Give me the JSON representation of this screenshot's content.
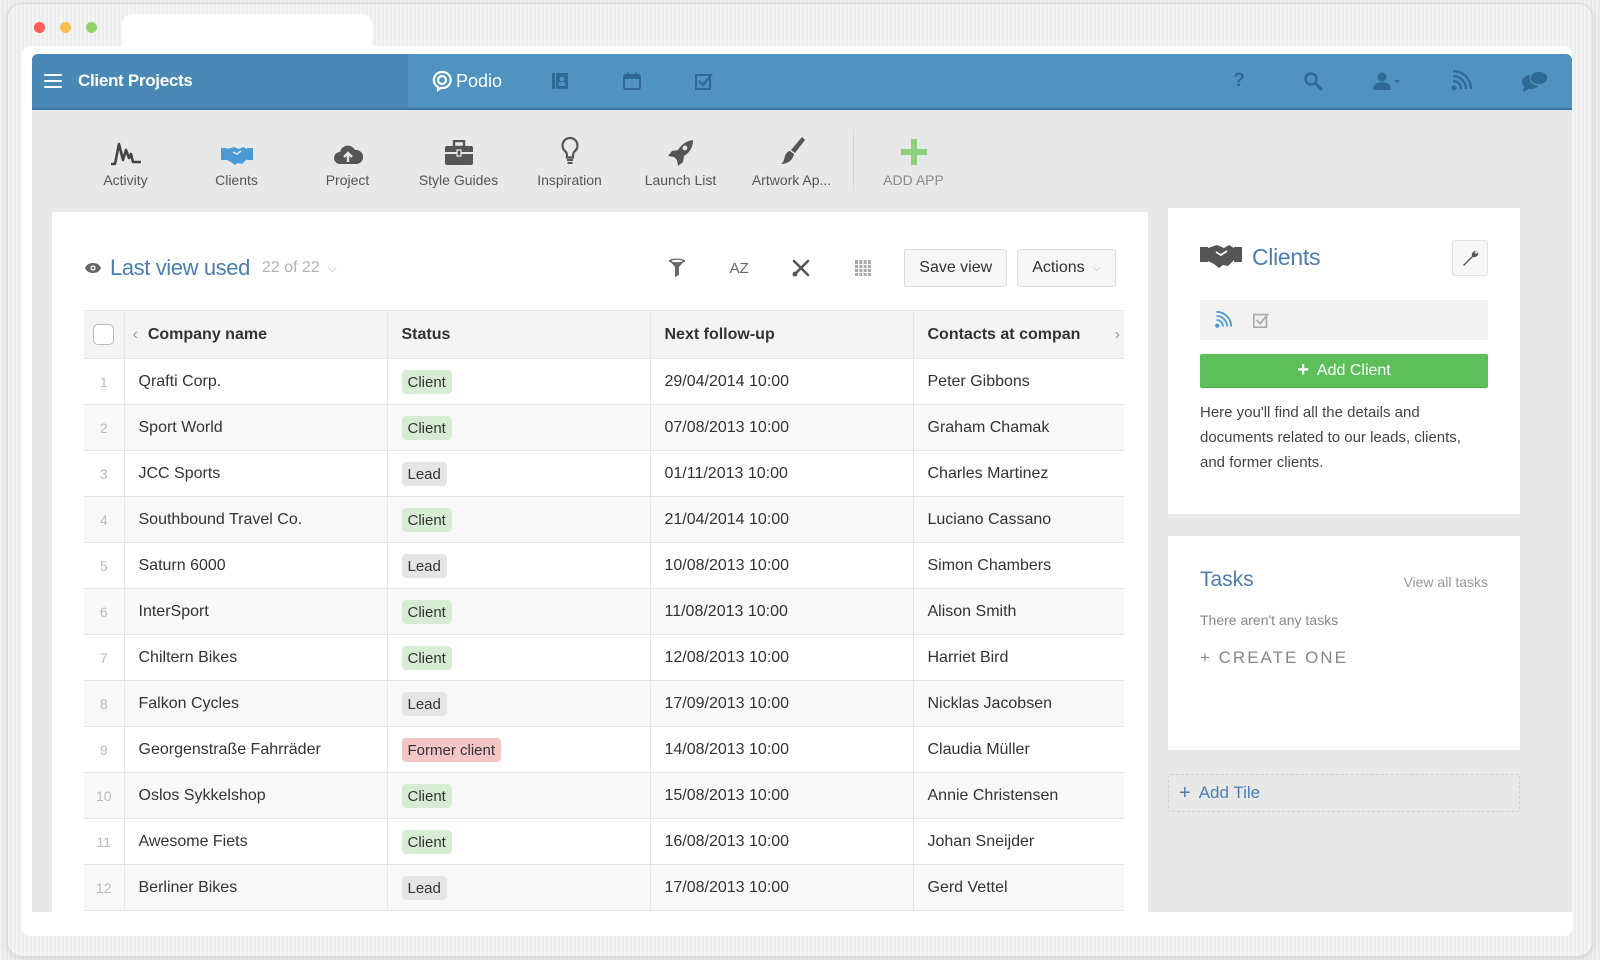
{
  "browser": {
    "traffic_lights": [
      "close",
      "minimize",
      "maximize"
    ]
  },
  "topbar": {
    "workspace_title": "Client Projects",
    "brand": "Podio",
    "nav_icons": [
      "contacts-icon",
      "calendar-icon",
      "tasks-icon"
    ],
    "right_icons": [
      "help-icon",
      "search-icon",
      "user-menu-icon",
      "activity-stream-icon",
      "chat-icon"
    ],
    "help_glyph": "?"
  },
  "apps": [
    {
      "label": "Activity",
      "icon": "activity-icon"
    },
    {
      "label": "Clients",
      "icon": "handshake-icon",
      "active": true
    },
    {
      "label": "Project",
      "icon": "cloud-upload-icon"
    },
    {
      "label": "Style Guides",
      "icon": "toolbox-icon"
    },
    {
      "label": "Inspiration",
      "icon": "lightbulb-icon"
    },
    {
      "label": "Launch List",
      "icon": "rocket-icon"
    },
    {
      "label": "Artwork Ap...",
      "icon": "brush-icon"
    },
    {
      "label": "ADD APP",
      "icon": "plus-icon"
    }
  ],
  "view": {
    "title": "Last view used",
    "count": "22 of 22",
    "tools": [
      "filter-icon",
      "sort-az-icon",
      "tools-icon",
      "columns-icon"
    ],
    "sort_label": "AZ",
    "save_view": "Save view",
    "actions": "Actions"
  },
  "table": {
    "columns": [
      "Company name",
      "Status",
      "Next follow-up",
      "Contacts at compan"
    ],
    "rows": [
      {
        "num": "1",
        "company": "Qrafti Corp.",
        "status": "Client",
        "followup": "29/04/2014 10:00",
        "contact": "Peter Gibbons"
      },
      {
        "num": "2",
        "company": "Sport World",
        "status": "Client",
        "followup": "07/08/2013 10:00",
        "contact": "Graham Chamak"
      },
      {
        "num": "3",
        "company": "JCC Sports",
        "status": "Lead",
        "followup": "01/11/2013 10:00",
        "contact": "Charles Martinez"
      },
      {
        "num": "4",
        "company": "Southbound Travel Co.",
        "status": "Client",
        "followup": "21/04/2014 10:00",
        "contact": "Luciano Cassano"
      },
      {
        "num": "5",
        "company": "Saturn 6000",
        "status": "Lead",
        "followup": "10/08/2013 10:00",
        "contact": "Simon Chambers"
      },
      {
        "num": "6",
        "company": "InterSport",
        "status": "Client",
        "followup": "11/08/2013 10:00",
        "contact": "Alison Smith"
      },
      {
        "num": "7",
        "company": "Chiltern Bikes",
        "status": "Client",
        "followup": "12/08/2013 10:00",
        "contact": "Harriet Bird"
      },
      {
        "num": "8",
        "company": "Falkon Cycles",
        "status": "Lead",
        "followup": "17/09/2013 10:00",
        "contact": "Nicklas Jacobsen"
      },
      {
        "num": "9",
        "company": "Georgenstraße Fahrräder",
        "status": "Former client",
        "followup": "14/08/2013 10:00",
        "contact": "Claudia Müller"
      },
      {
        "num": "10",
        "company": "Oslos Sykkelshop",
        "status": "Client",
        "followup": "15/08/2013 10:00",
        "contact": "Annie Christensen"
      },
      {
        "num": "11",
        "company": "Awesome Fiets",
        "status": "Client",
        "followup": "16/08/2013 10:00",
        "contact": "Johan Sneijder"
      },
      {
        "num": "12",
        "company": "Berliner Bikes",
        "status": "Lead",
        "followup": "17/08/2013 10:00",
        "contact": "Gerd Vettel"
      }
    ],
    "status_colors": {
      "Client": "#d7edd3",
      "Lead": "#e5e5e5",
      "Former client": "#f5c6c6"
    }
  },
  "sidebar": {
    "clients": {
      "title": "Clients",
      "add_button": "Add Client",
      "description": "Here you'll find all the details and documents related to our leads, clients, and former clients."
    },
    "tasks": {
      "title": "Tasks",
      "view_all": "View all tasks",
      "empty": "There aren't any tasks",
      "create": "+ CREATE ONE"
    },
    "add_tile": "Add Tile"
  },
  "colors": {
    "topbar": "#5092c0",
    "accent_blue": "#4a7eaf",
    "add_green": "#5cbf5a"
  }
}
